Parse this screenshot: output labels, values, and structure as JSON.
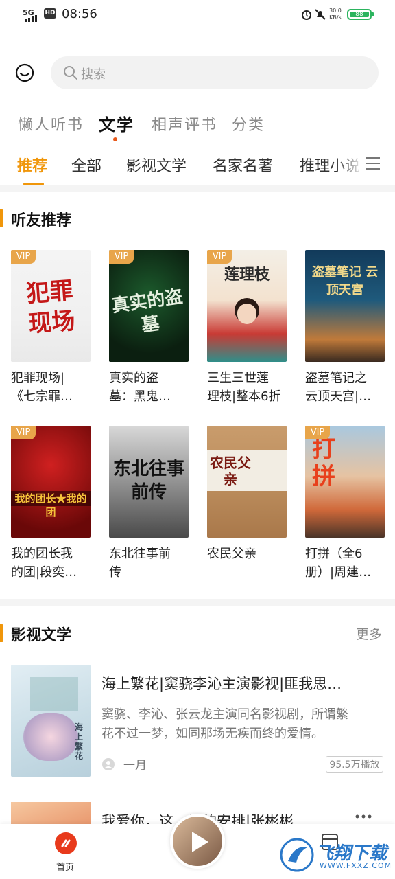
{
  "status_bar": {
    "network": "5G",
    "hd": "HD",
    "time": "08:56",
    "speed_value": "30.0",
    "speed_unit": "KB/s",
    "battery": "88"
  },
  "search": {
    "placeholder": "搜索"
  },
  "top_categories": [
    {
      "label": "懒人听书",
      "active": false
    },
    {
      "label": "文学",
      "active": true
    },
    {
      "label": "相声评书",
      "active": false
    },
    {
      "label": "分类",
      "active": false
    }
  ],
  "sub_tabs": [
    {
      "label": "推荐",
      "active": true
    },
    {
      "label": "全部",
      "active": false
    },
    {
      "label": "影视文学",
      "active": false
    },
    {
      "label": "名家名著",
      "active": false
    },
    {
      "label": "推理小说",
      "active": false
    }
  ],
  "section1": {
    "title": "听友推荐",
    "vip_label": "VIP",
    "books": [
      {
        "title_line1": "犯罪现场|",
        "title_line2": "《七宗罪…",
        "cover_text": "犯罪现场",
        "vip": true
      },
      {
        "title_line1": "真实的盗",
        "title_line2": "墓：黑鬼…",
        "cover_text": "真实的盗墓",
        "vip": true
      },
      {
        "title_line1": "三生三世莲",
        "title_line2": "理枝|整本6折",
        "cover_text": "莲理枝",
        "vip": true
      },
      {
        "title_line1": "盗墓笔记之",
        "title_line2": "云顶天宫|…",
        "cover_text": "盗墓笔记 云顶天宫",
        "vip": false
      },
      {
        "title_line1": "我的团长我",
        "title_line2": "的团|段奕…",
        "cover_text": "我的团长★我的团",
        "vip": true
      },
      {
        "title_line1": "东北往事前",
        "title_line2": "传",
        "cover_text": "东北往事 前传",
        "vip": false
      },
      {
        "title_line1": "农民父亲",
        "title_line2": "",
        "cover_text": "农民父亲",
        "vip": false
      },
      {
        "title_line1": "打拼（全6",
        "title_line2": "册）|周建…",
        "cover_text": "打拼",
        "vip": true
      }
    ]
  },
  "section2": {
    "title": "影视文学",
    "more": "更多",
    "items": [
      {
        "title": "海上繁花|窦骁李沁主演影视|匪我思…",
        "desc_line1": "窦骁、李沁、张云龙主演同名影视剧，所谓繁",
        "desc_line2": "花不过一梦，如同那场无疾而终的爱情。",
        "author": "一月",
        "plays": "95.5万播放",
        "cover_text": "海上繁花"
      },
      {
        "title": "我爱你，这…好的安排|张彬彬…"
      }
    ]
  },
  "bottom_nav": {
    "home": "首页"
  },
  "watermark": {
    "text": "飞翔下载",
    "sub": "WWW.FXXZ.COM"
  }
}
